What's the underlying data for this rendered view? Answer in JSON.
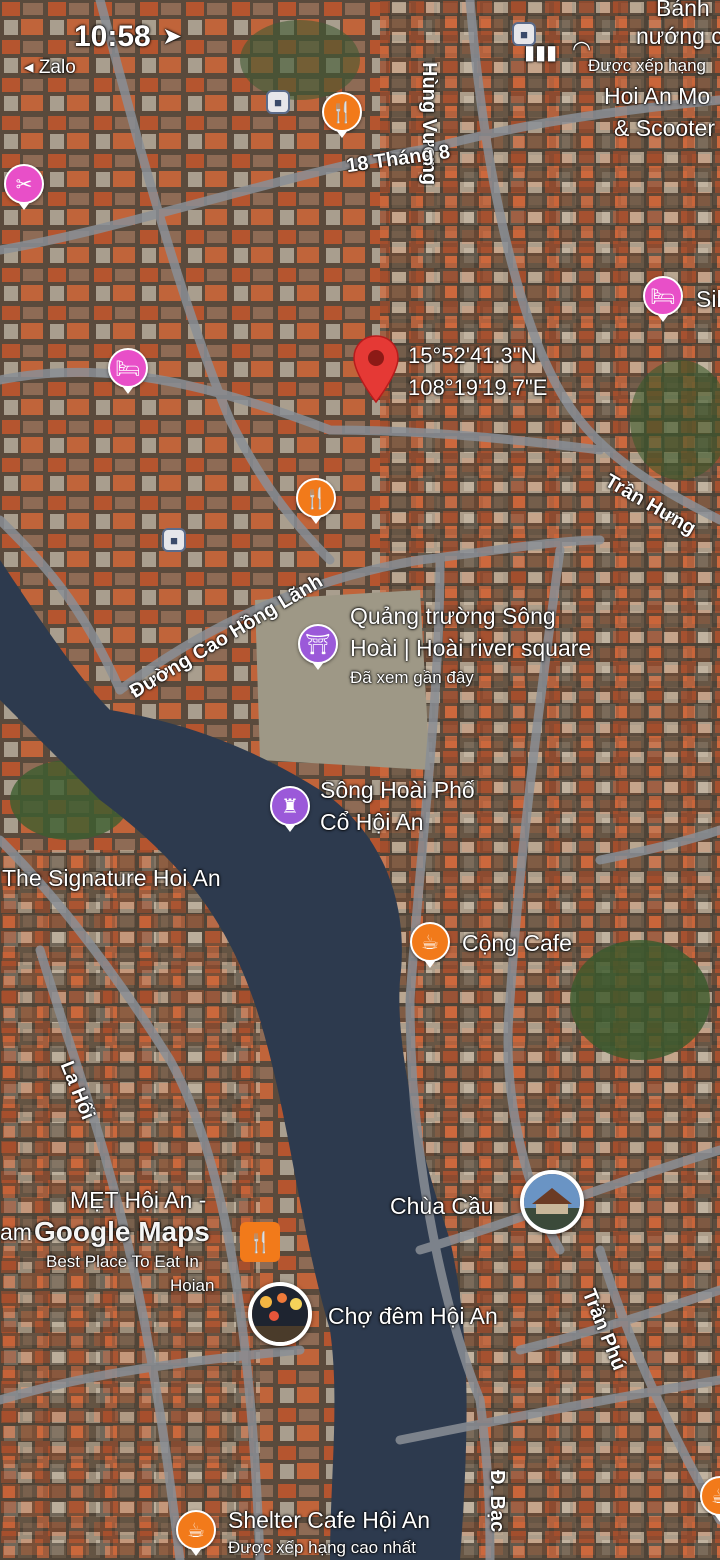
{
  "status_bar": {
    "time": "10:58",
    "back_app": "Zalo"
  },
  "pin": {
    "lat": "15°52'41.3\"N",
    "lon": "108°19'19.7\"E"
  },
  "roads": {
    "hung_vuong": "Hùng Vương",
    "thang8": "18 Tháng 8",
    "tran_hung": "Trần Hưng",
    "cao_hong_lanh": "Đường Cao Hồng Lãnh",
    "la_hoi": "La Hối",
    "tran_phu": "Trần Phú",
    "bach": "Đ. Bạc"
  },
  "places": {
    "top_right_1": "Bánh",
    "top_right_2": "nướng c",
    "top_right_3": "Được xếp hạng",
    "top_right_4": "Hoi An Mo",
    "top_right_5": "& Scooter",
    "sil": "Sil",
    "square_1": "Quảng trường Sông",
    "square_2": "Hoài | Hoài river square",
    "square_seen": "Đã xem gần đây",
    "song_hoai_1": "Sông Hoài Phố",
    "song_hoai_2": "Cổ Hội An",
    "signature": "The Signature Hoi An",
    "cong_cafe": "Cộng Cafe",
    "chua_cau": "Chùa Cầu",
    "met_1": "MẸT Hội An -",
    "met_2": "Best Place To Eat In",
    "met_3": "Hoian",
    "cho_dem": "Chợ đêm Hội An",
    "shelter": "Shelter Cafe Hội An",
    "shelter_sub": "Được xếp hạng cao nhất",
    "am": "am"
  },
  "google_logo": "Google Maps",
  "icons": {
    "fork_knife": "🍴",
    "bed": "🛏",
    "cup": "☕",
    "bus": "🚌",
    "monument": "⛩",
    "tower": "♜"
  },
  "colors": {
    "pin": "#e53935",
    "water": "#2d3a4e",
    "food": "#f27a1a",
    "hotel": "#e84fc8",
    "attraction": "#9b59d9"
  }
}
